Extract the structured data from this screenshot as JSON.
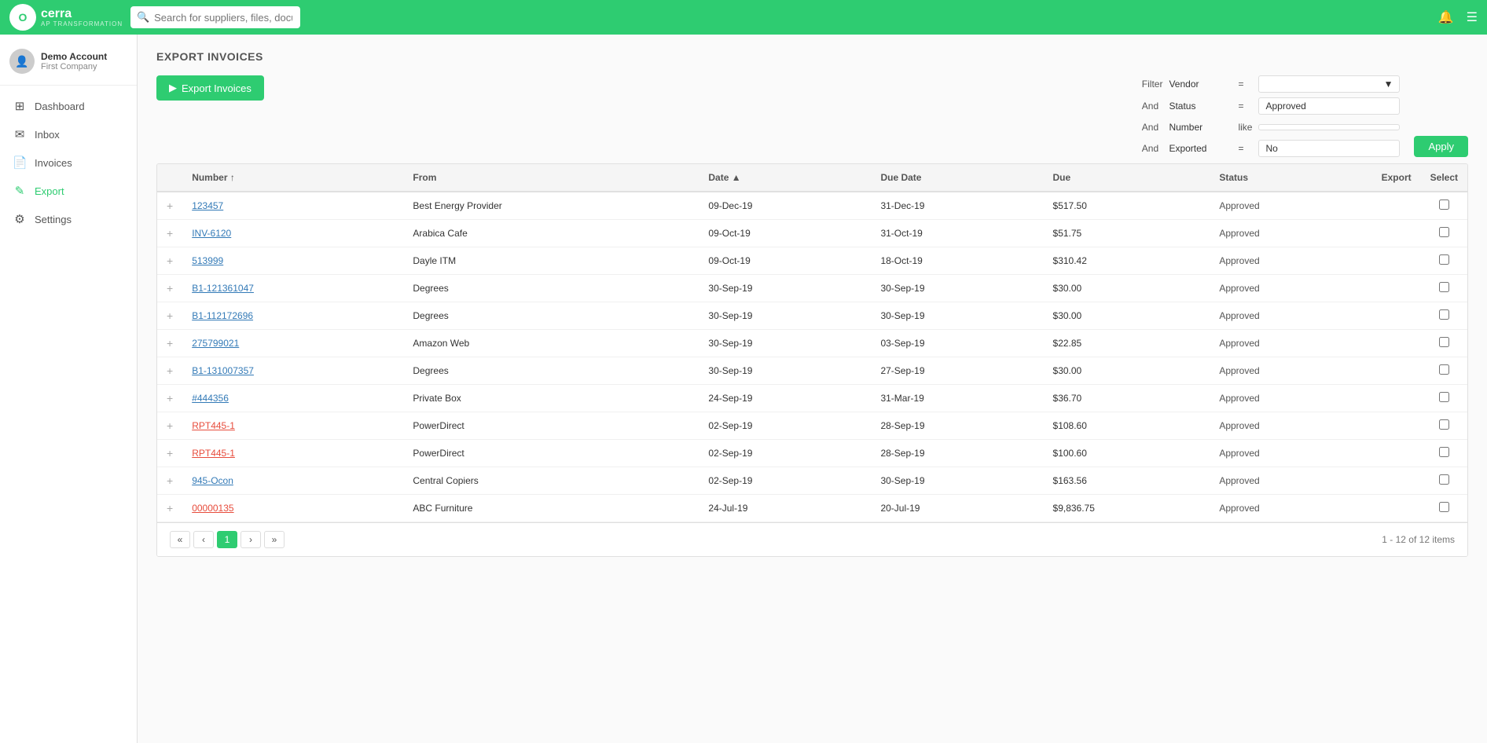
{
  "topnav": {
    "logo_text": "cerra",
    "logo_sub": "AP TRANSFORMATION",
    "search_placeholder": "Search for suppliers, files, documents...",
    "logo_initial": "O"
  },
  "sidebar": {
    "user_name": "Demo Account",
    "user_company": "First Company",
    "items": [
      {
        "id": "dashboard",
        "label": "Dashboard",
        "icon": "⊞"
      },
      {
        "id": "inbox",
        "label": "Inbox",
        "icon": "✉"
      },
      {
        "id": "invoices",
        "label": "Invoices",
        "icon": "📄"
      },
      {
        "id": "export",
        "label": "Export",
        "icon": "✎",
        "active": true
      },
      {
        "id": "settings",
        "label": "Settings",
        "icon": "⚙"
      }
    ]
  },
  "page": {
    "title": "EXPORT INVOICES",
    "export_button_label": "Export Invoices"
  },
  "filters": {
    "label": "Filter",
    "rows": [
      {
        "connector": "Filter",
        "field": "Vendor",
        "op": "=",
        "value": "",
        "hasDropdown": true
      },
      {
        "connector": "And",
        "field": "Status",
        "op": "=",
        "value": "Approved",
        "hasDropdown": false
      },
      {
        "connector": "And",
        "field": "Number",
        "op": "like",
        "value": "",
        "hasDropdown": false
      },
      {
        "connector": "And",
        "field": "Exported",
        "op": "=",
        "value": "No",
        "hasDropdown": false
      }
    ],
    "apply_label": "Apply"
  },
  "table": {
    "columns": [
      {
        "id": "expand",
        "label": ""
      },
      {
        "id": "number",
        "label": "Number",
        "sortable": true
      },
      {
        "id": "from",
        "label": "From"
      },
      {
        "id": "date",
        "label": "Date",
        "sortable": true,
        "sorted": true
      },
      {
        "id": "due_date",
        "label": "Due Date"
      },
      {
        "id": "due",
        "label": "Due"
      },
      {
        "id": "status",
        "label": "Status"
      },
      {
        "id": "export",
        "label": "Export"
      },
      {
        "id": "select",
        "label": "Select"
      }
    ],
    "rows": [
      {
        "number": "123457",
        "from": "Best Energy Provider",
        "date": "09-Dec-19",
        "due_date": "31-Dec-19",
        "due": "$517.50",
        "status": "Approved",
        "link_style": "normal"
      },
      {
        "number": "INV-6120",
        "from": "Arabica Cafe",
        "date": "09-Oct-19",
        "due_date": "31-Oct-19",
        "due": "$51.75",
        "status": "Approved",
        "link_style": "normal"
      },
      {
        "number": "513999",
        "from": "Dayle ITM",
        "date": "09-Oct-19",
        "due_date": "18-Oct-19",
        "due": "$310.42",
        "status": "Approved",
        "link_style": "normal"
      },
      {
        "number": "B1-121361047",
        "from": "Degrees",
        "date": "30-Sep-19",
        "due_date": "30-Sep-19",
        "due": "$30.00",
        "status": "Approved",
        "link_style": "normal"
      },
      {
        "number": "B1-112172696",
        "from": "Degrees",
        "date": "30-Sep-19",
        "due_date": "30-Sep-19",
        "due": "$30.00",
        "status": "Approved",
        "link_style": "normal"
      },
      {
        "number": "275799021",
        "from": "Amazon Web",
        "date": "30-Sep-19",
        "due_date": "03-Sep-19",
        "due": "$22.85",
        "status": "Approved",
        "link_style": "normal"
      },
      {
        "number": "B1-131007357",
        "from": "Degrees",
        "date": "30-Sep-19",
        "due_date": "27-Sep-19",
        "due": "$30.00",
        "status": "Approved",
        "link_style": "normal"
      },
      {
        "number": "#444356",
        "from": "Private Box",
        "date": "24-Sep-19",
        "due_date": "31-Mar-19",
        "due": "$36.70",
        "status": "Approved",
        "link_style": "normal"
      },
      {
        "number": "RPT445-1",
        "from": "PowerDirect",
        "date": "02-Sep-19",
        "due_date": "28-Sep-19",
        "due": "$108.60",
        "status": "Approved",
        "link_style": "red"
      },
      {
        "number": "RPT445-1",
        "from": "PowerDirect",
        "date": "02-Sep-19",
        "due_date": "28-Sep-19",
        "due": "$100.60",
        "status": "Approved",
        "link_style": "red"
      },
      {
        "number": "945-Ocon",
        "from": "Central Copiers",
        "date": "02-Sep-19",
        "due_date": "30-Sep-19",
        "due": "$163.56",
        "status": "Approved",
        "link_style": "normal"
      },
      {
        "number": "00000135",
        "from": "ABC Furniture",
        "date": "24-Jul-19",
        "due_date": "20-Jul-19",
        "due": "$9,836.75",
        "status": "Approved",
        "link_style": "red"
      }
    ]
  },
  "pagination": {
    "current_page": 1,
    "total_pages": 1,
    "info": "1 - 12 of 12 items"
  }
}
